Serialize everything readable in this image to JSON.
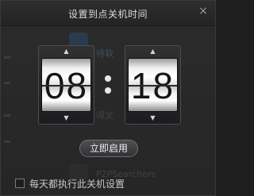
{
  "dialog": {
    "title": "设置到点关机时间",
    "close_glyph": "×"
  },
  "background": {
    "items": [
      {
        "text": "待软",
        "color": "#3a5f8f"
      },
      {
        "text": "得文",
        "color": "#444b55"
      },
      {
        "text": "P2PSearchers",
        "color": "#3e3e3e"
      }
    ]
  },
  "timer": {
    "hour": "08",
    "minute": "18",
    "up_glyph": "▲",
    "down_glyph": "▼"
  },
  "actions": {
    "start_label": "立即启用"
  },
  "options": {
    "repeat_label": "每天都执行此关机设置",
    "repeat_checked": false
  }
}
